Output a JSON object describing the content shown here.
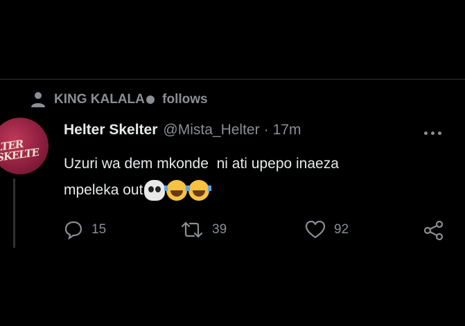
{
  "social_context": {
    "user": "KING KALALA",
    "follows_label": "follows"
  },
  "tweet": {
    "display_name": "Helter Skelter",
    "handle": "@Mista_Helter",
    "separator": "·",
    "time": "17m",
    "text": "Uzuri wa dem mkonde  ni ati upepo inaeza\nmpeleka out",
    "emojis": [
      "skull-emoji",
      "tears-of-joy-emoji",
      "tears-of-joy-emoji"
    ],
    "avatar_text": "Helter\nSkelter"
  },
  "actions": {
    "reply_count": "15",
    "retweet_count": "39",
    "like_count": "92"
  },
  "icons": [
    "person-icon",
    "more-icon",
    "reply-icon",
    "retweet-icon",
    "like-icon",
    "share-icon"
  ],
  "colors": {
    "background": "#000000",
    "primary_text": "#e7e9ea",
    "secondary_text": "#8b8f93",
    "divider": "#2f3336"
  }
}
